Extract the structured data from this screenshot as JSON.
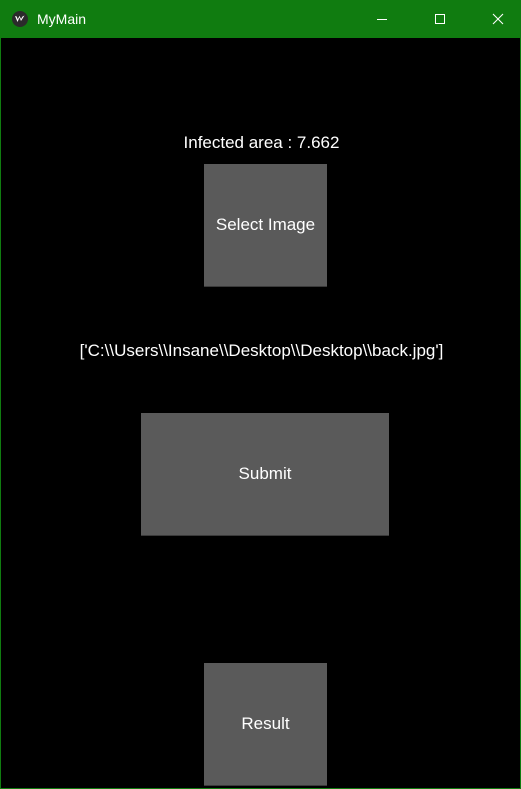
{
  "window": {
    "title": "MyMain",
    "titlebar_color": "#107c10",
    "controls": {
      "minimize_icon": "minimize-icon",
      "maximize_icon": "maximize-icon",
      "close_icon": "close-icon"
    }
  },
  "main": {
    "infected_area_text": "Infected area : 7.662",
    "select_image_label": "Select Image",
    "selected_path_text": "['C:\\\\Users\\\\Insane\\\\Desktop\\\\Desktop\\\\back.jpg']",
    "submit_label": "Submit",
    "result_label": "Result"
  },
  "colors": {
    "background": "#000000",
    "button": "#5a5a5a",
    "text": "#ffffff"
  }
}
